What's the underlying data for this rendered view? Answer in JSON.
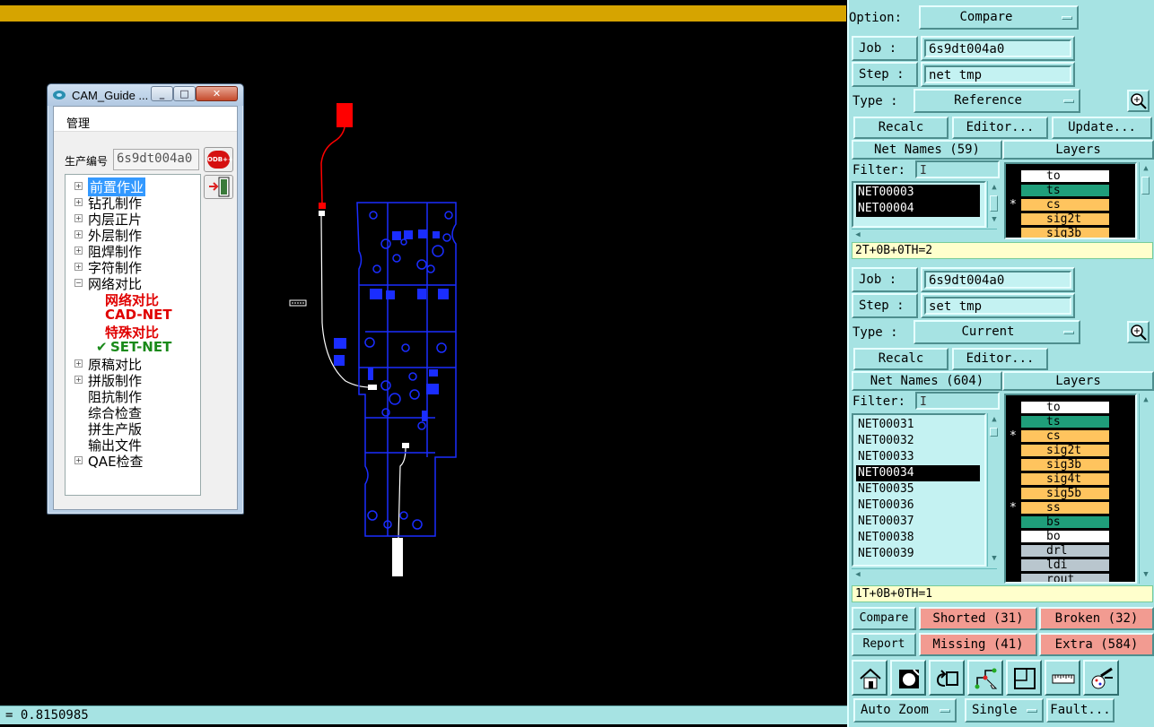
{
  "status": {
    "text": "= 0.8150985"
  },
  "cam_window": {
    "title": "CAM_Guide ...",
    "menu": "管理",
    "prod_label": "生产编号",
    "prod_value": "6s9dt004a0",
    "odb_button": "ODB++",
    "tree": [
      {
        "label": "前置作业",
        "expander": "+",
        "selected": true
      },
      {
        "label": "钻孔制作",
        "expander": "+"
      },
      {
        "label": "内层正片",
        "expander": "+"
      },
      {
        "label": "外层制作",
        "expander": "+"
      },
      {
        "label": "阻焊制作",
        "expander": "+"
      },
      {
        "label": "字符制作",
        "expander": "+"
      },
      {
        "label": "网络对比",
        "expander": "−"
      },
      {
        "label": "网络对比",
        "child": true
      },
      {
        "label": "CAD-NET",
        "child": true
      },
      {
        "label": "特殊对比",
        "child": true
      },
      {
        "label": "SET-NET",
        "child": true,
        "checked": true
      },
      {
        "label": "原稿对比",
        "expander": "+"
      },
      {
        "label": "拼版制作",
        "expander": "+"
      },
      {
        "label": "阻抗制作"
      },
      {
        "label": "综合检查"
      },
      {
        "label": "拼生产版"
      },
      {
        "label": "输出文件"
      },
      {
        "label": "QAE检查",
        "expander": "+"
      }
    ]
  },
  "panel": {
    "option_label": "Option:",
    "option_value": "Compare",
    "ref": {
      "job_label": "Job  :",
      "job_value": "6s9dt004a0",
      "step_label": "Step :",
      "step_value": "net_tmp",
      "type_label": "Type :",
      "type_value": "Reference",
      "recalc": "Recalc",
      "editor": "Editor...",
      "update": "Update...",
      "net_names": "Net Names (59)",
      "layers_header": "Layers",
      "filter_label": "Filter:",
      "nets": [
        "NET00003",
        "NET00004"
      ],
      "layers": [
        {
          "name": "to",
          "color": "#ffffff",
          "star": ""
        },
        {
          "name": "ts",
          "color": "#1f9e7a",
          "star": ""
        },
        {
          "name": "cs",
          "color": "#ffc45e",
          "star": "*"
        },
        {
          "name": "sig2t",
          "color": "#ffc45e",
          "star": ""
        },
        {
          "name": "sig3b",
          "color": "#ffc45e",
          "star": ""
        }
      ],
      "summary": "2T+0B+0TH=2"
    },
    "cur": {
      "job_label": "Job  :",
      "job_value": "6s9dt004a0",
      "step_label": "Step :",
      "step_value": "set_tmp",
      "type_label": "Type :",
      "type_value": "Current",
      "recalc": "Recalc",
      "editor": "Editor...",
      "net_names": "Net Names (604)",
      "layers_header": "Layers",
      "filter_label": "Filter:",
      "nets": [
        "NET00031",
        "NET00032",
        "NET00033",
        "NET00034",
        "NET00035",
        "NET00036",
        "NET00037",
        "NET00038",
        "NET00039"
      ],
      "selected_net": "NET00034",
      "layers": [
        {
          "name": "to",
          "color": "#ffffff",
          "star": ""
        },
        {
          "name": "ts",
          "color": "#1f9e7a",
          "star": ""
        },
        {
          "name": "cs",
          "color": "#ffc45e",
          "star": "*"
        },
        {
          "name": "sig2t",
          "color": "#ffc45e",
          "star": ""
        },
        {
          "name": "sig3b",
          "color": "#ffc45e",
          "star": ""
        },
        {
          "name": "sig4t",
          "color": "#ffc45e",
          "star": ""
        },
        {
          "name": "sig5b",
          "color": "#ffc45e",
          "star": ""
        },
        {
          "name": "ss",
          "color": "#ffc45e",
          "star": "*"
        },
        {
          "name": "bs",
          "color": "#1f9e7a",
          "star": ""
        },
        {
          "name": "bo",
          "color": "#ffffff",
          "star": ""
        },
        {
          "name": "drl",
          "color": "#b9c6ce",
          "star": ""
        },
        {
          "name": "ldi",
          "color": "#b9c6ce",
          "star": ""
        },
        {
          "name": "rout",
          "color": "#b9c6ce",
          "star": ""
        }
      ],
      "summary": "1T+0B+0TH=1"
    },
    "results": {
      "compare": "Compare",
      "report": "Report",
      "shorted": "Shorted (31)",
      "broken": "Broken (32)",
      "missing": "Missing (41)",
      "extra": "Extra (584)"
    },
    "icons": [
      "home-icon",
      "snapshot-icon",
      "undo-icon",
      "net-trace-icon",
      "window-icon",
      "ruler-icon",
      "tools-icon"
    ],
    "bottom": {
      "zoom": "Auto Zoom",
      "mode": "Single",
      "fault": "Fault..."
    }
  }
}
